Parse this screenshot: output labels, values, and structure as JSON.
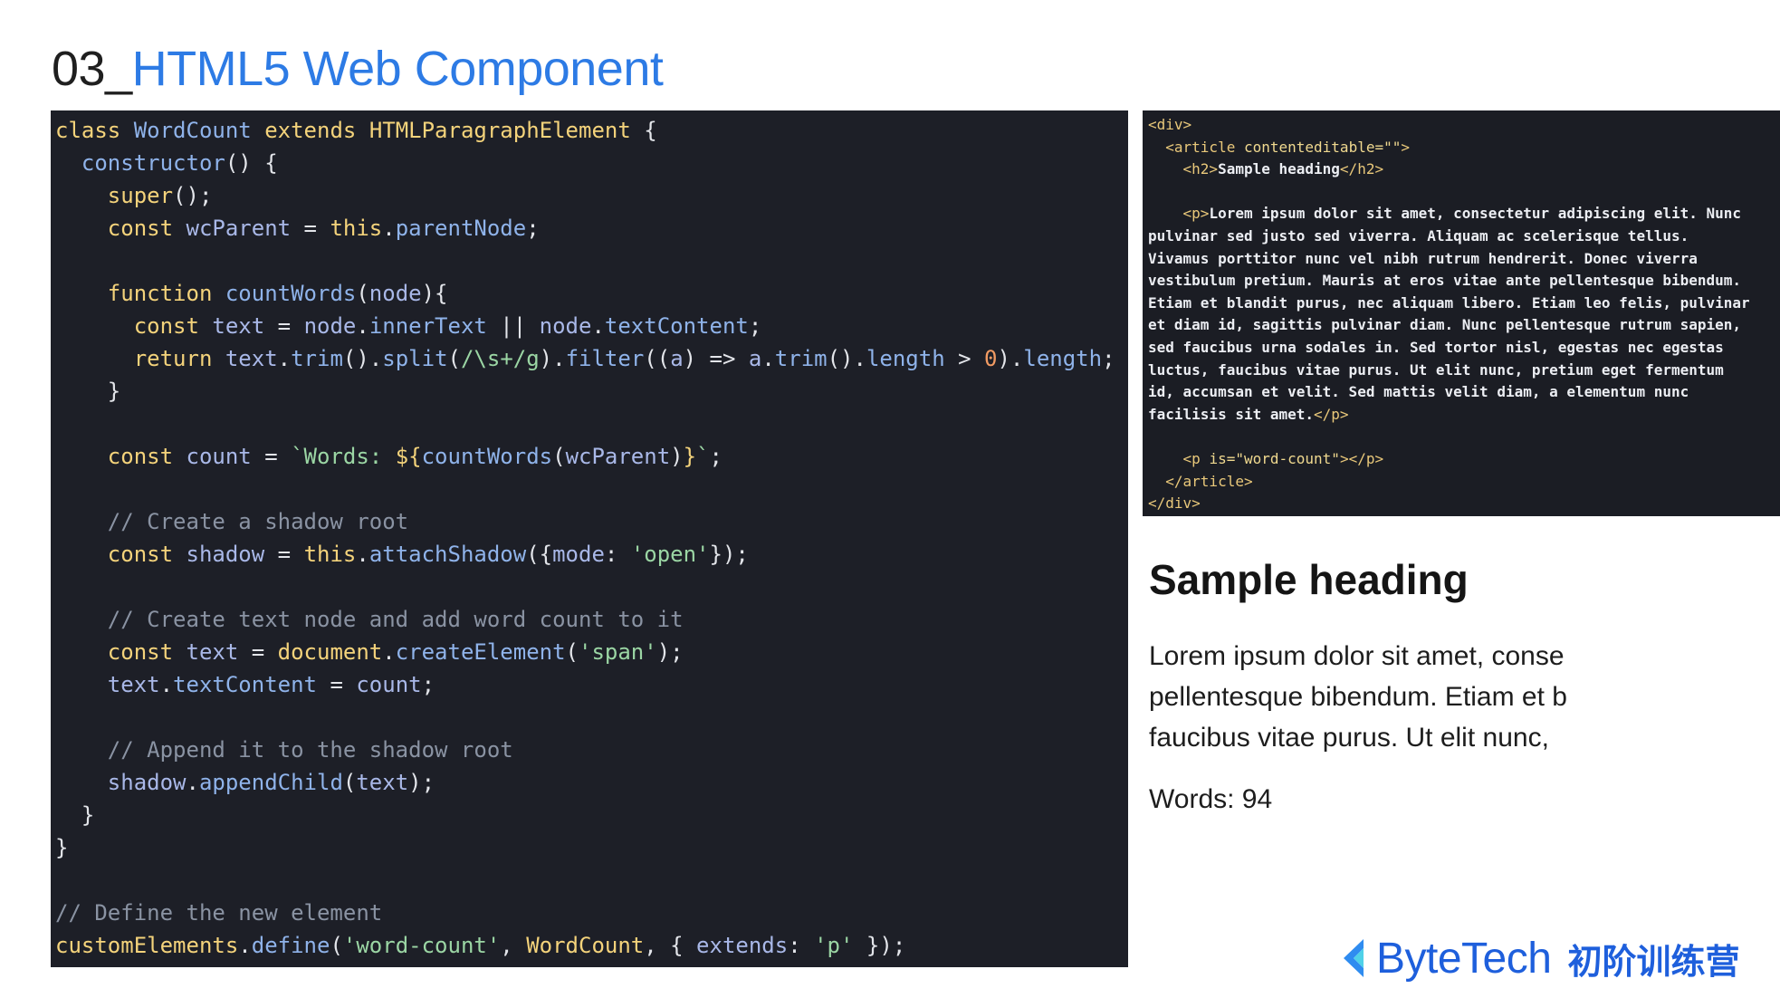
{
  "slide": {
    "title_number": "03_",
    "title_text": "HTML5 Web Component"
  },
  "code": {
    "lines": [
      [
        [
          "k",
          "class"
        ],
        [
          "p",
          " "
        ],
        [
          "f",
          "WordCount"
        ],
        [
          "p",
          " "
        ],
        [
          "k",
          "extends"
        ],
        [
          "p",
          " "
        ],
        [
          "k",
          "HTMLParagraphElement"
        ],
        [
          "p",
          " {"
        ]
      ],
      [
        [
          "p",
          "  "
        ],
        [
          "f",
          "constructor"
        ],
        [
          "p",
          "() {"
        ]
      ],
      [
        [
          "p",
          "    "
        ],
        [
          "k",
          "super"
        ],
        [
          "p",
          "();"
        ]
      ],
      [
        [
          "p",
          "    "
        ],
        [
          "k",
          "const"
        ],
        [
          "p",
          " "
        ],
        [
          "v",
          "wcParent"
        ],
        [
          "p",
          " = "
        ],
        [
          "k",
          "this"
        ],
        [
          "p",
          "."
        ],
        [
          "f",
          "parentNode"
        ],
        [
          "p",
          ";"
        ]
      ],
      [],
      [
        [
          "p",
          "    "
        ],
        [
          "k",
          "function"
        ],
        [
          "p",
          " "
        ],
        [
          "f",
          "countWords"
        ],
        [
          "p",
          "("
        ],
        [
          "v",
          "node"
        ],
        [
          "p",
          "){"
        ]
      ],
      [
        [
          "p",
          "      "
        ],
        [
          "k",
          "const"
        ],
        [
          "p",
          " "
        ],
        [
          "v",
          "text"
        ],
        [
          "p",
          " = "
        ],
        [
          "v",
          "node"
        ],
        [
          "p",
          "."
        ],
        [
          "f",
          "innerText"
        ],
        [
          "p",
          " || "
        ],
        [
          "v",
          "node"
        ],
        [
          "p",
          "."
        ],
        [
          "f",
          "textContent"
        ],
        [
          "p",
          ";"
        ]
      ],
      [
        [
          "p",
          "      "
        ],
        [
          "k",
          "return"
        ],
        [
          "p",
          " "
        ],
        [
          "v",
          "text"
        ],
        [
          "p",
          "."
        ],
        [
          "f",
          "trim"
        ],
        [
          "p",
          "()."
        ],
        [
          "f",
          "split"
        ],
        [
          "p",
          "("
        ],
        [
          "s",
          "/\\s+/g"
        ],
        [
          "p",
          ")."
        ],
        [
          "f",
          "filter"
        ],
        [
          "p",
          "(("
        ],
        [
          "v",
          "a"
        ],
        [
          "p",
          ") => "
        ],
        [
          "v",
          "a"
        ],
        [
          "p",
          "."
        ],
        [
          "f",
          "trim"
        ],
        [
          "p",
          "()."
        ],
        [
          "f",
          "length"
        ],
        [
          "p",
          " > "
        ],
        [
          "n",
          "0"
        ],
        [
          "p",
          ")."
        ],
        [
          "f",
          "length"
        ],
        [
          "p",
          ";"
        ]
      ],
      [
        [
          "p",
          "    }"
        ]
      ],
      [],
      [
        [
          "p",
          "    "
        ],
        [
          "k",
          "const"
        ],
        [
          "p",
          " "
        ],
        [
          "v",
          "count"
        ],
        [
          "p",
          " = "
        ],
        [
          "s",
          "`Words: "
        ],
        [
          "k",
          "${"
        ],
        [
          "f",
          "countWords"
        ],
        [
          "p",
          "("
        ],
        [
          "v",
          "wcParent"
        ],
        [
          "p",
          ")"
        ],
        [
          "k",
          "}"
        ],
        [
          "s",
          "`"
        ],
        [
          "p",
          ";"
        ]
      ],
      [],
      [
        [
          "c",
          "    // Create a shadow root"
        ]
      ],
      [
        [
          "p",
          "    "
        ],
        [
          "k",
          "const"
        ],
        [
          "p",
          " "
        ],
        [
          "v",
          "shadow"
        ],
        [
          "p",
          " = "
        ],
        [
          "k",
          "this"
        ],
        [
          "p",
          "."
        ],
        [
          "f",
          "attachShadow"
        ],
        [
          "p",
          "({"
        ],
        [
          "v",
          "mode"
        ],
        [
          "p",
          ": "
        ],
        [
          "s",
          "'open'"
        ],
        [
          "p",
          "});"
        ]
      ],
      [],
      [
        [
          "c",
          "    // Create text node and add word count to it"
        ]
      ],
      [
        [
          "p",
          "    "
        ],
        [
          "k",
          "const"
        ],
        [
          "p",
          " "
        ],
        [
          "v",
          "text"
        ],
        [
          "p",
          " = "
        ],
        [
          "k",
          "document"
        ],
        [
          "p",
          "."
        ],
        [
          "f",
          "createElement"
        ],
        [
          "p",
          "("
        ],
        [
          "s",
          "'span'"
        ],
        [
          "p",
          ");"
        ]
      ],
      [
        [
          "p",
          "    "
        ],
        [
          "v",
          "text"
        ],
        [
          "p",
          "."
        ],
        [
          "f",
          "textContent"
        ],
        [
          "p",
          " = "
        ],
        [
          "v",
          "count"
        ],
        [
          "p",
          ";"
        ]
      ],
      [],
      [
        [
          "c",
          "    // Append it to the shadow root"
        ]
      ],
      [
        [
          "p",
          "    "
        ],
        [
          "v",
          "shadow"
        ],
        [
          "p",
          "."
        ],
        [
          "f",
          "appendChild"
        ],
        [
          "p",
          "("
        ],
        [
          "v",
          "text"
        ],
        [
          "p",
          ");"
        ]
      ],
      [
        [
          "p",
          "  }"
        ]
      ],
      [
        [
          "p",
          "}"
        ]
      ],
      [],
      [
        [
          "c",
          "// Define the new element"
        ]
      ],
      [
        [
          "k",
          "customElements"
        ],
        [
          "p",
          "."
        ],
        [
          "f",
          "define"
        ],
        [
          "p",
          "("
        ],
        [
          "s",
          "'word-count'"
        ],
        [
          "p",
          ", "
        ],
        [
          "k",
          "WordCount"
        ],
        [
          "p",
          ", { "
        ],
        [
          "v",
          "extends"
        ],
        [
          "p",
          ": "
        ],
        [
          "s",
          "'p'"
        ],
        [
          "p",
          " });"
        ]
      ]
    ]
  },
  "html_source": {
    "lines": [
      [
        [
          "t",
          "<div>"
        ]
      ],
      [
        [
          "p",
          "  "
        ],
        [
          "t",
          "<article "
        ],
        [
          "a",
          "contenteditable=\"\""
        ],
        [
          "t",
          ">"
        ]
      ],
      [
        [
          "p",
          "    "
        ],
        [
          "t",
          "<h2>"
        ],
        [
          "p",
          "Sample heading"
        ],
        [
          "t",
          "</h2>"
        ]
      ],
      [],
      [
        [
          "p",
          "    "
        ],
        [
          "t",
          "<p>"
        ],
        [
          "p",
          "Lorem ipsum dolor sit amet, consectetur adipiscing elit. Nunc"
        ]
      ],
      [
        [
          "p",
          "pulvinar sed justo sed viverra. Aliquam ac scelerisque tellus."
        ]
      ],
      [
        [
          "p",
          "Vivamus porttitor nunc vel nibh rutrum hendrerit. Donec viverra"
        ]
      ],
      [
        [
          "p",
          "vestibulum pretium. Mauris at eros vitae ante pellentesque bibendum."
        ]
      ],
      [
        [
          "p",
          "Etiam et blandit purus, nec aliquam libero. Etiam leo felis, pulvinar"
        ]
      ],
      [
        [
          "p",
          "et diam id, sagittis pulvinar diam. Nunc pellentesque rutrum sapien,"
        ]
      ],
      [
        [
          "p",
          "sed faucibus urna sodales in. Sed tortor nisl, egestas nec egestas"
        ]
      ],
      [
        [
          "p",
          "luctus, faucibus vitae purus. Ut elit nunc, pretium eget fermentum"
        ]
      ],
      [
        [
          "p",
          "id, accumsan et velit. Sed mattis velit diam, a elementum nunc"
        ]
      ],
      [
        [
          "p",
          "facilisis sit amet."
        ],
        [
          "t",
          "</p>"
        ]
      ],
      [],
      [
        [
          "p",
          "    "
        ],
        [
          "t",
          "<p "
        ],
        [
          "a",
          "is=\"word-count\""
        ],
        [
          "t",
          "></p>"
        ]
      ],
      [
        [
          "p",
          "  "
        ],
        [
          "t",
          "</article>"
        ]
      ],
      [
        [
          "t",
          "</div>"
        ]
      ]
    ]
  },
  "preview": {
    "heading": "Sample heading",
    "body_lines": [
      "Lorem ipsum dolor sit amet, conse",
      "pellentesque bibendum. Etiam et b",
      "faucibus vitae purus. Ut elit nunc, "
    ],
    "word_count": "Words: 94"
  },
  "brand": {
    "name": "ByteTech",
    "subtitle": "初阶训练营",
    "logo_icon": "bytetech-logo-icon",
    "color": "#1e5fdc"
  },
  "colors": {
    "title_accent": "#2d7be5",
    "code_background": "#1d1f27",
    "keyword": "#f4d37b",
    "identifier": "#8fb3ea",
    "string": "#9bd6a4",
    "comment": "#8a93a3"
  }
}
